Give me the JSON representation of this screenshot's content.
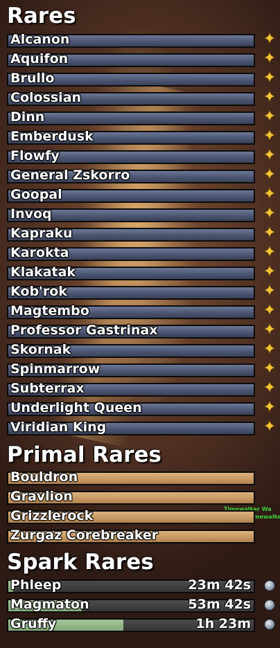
{
  "sections": {
    "rares": {
      "title": "Rares",
      "items": [
        "Alcanon",
        "Aquifon",
        "Brullo",
        "Colossian",
        "Dinn",
        "Emberdusk",
        "Flowfy",
        "General Zskorro",
        "Goopal",
        "Invoq",
        "Kapraku",
        "Karokta",
        "Klakatak",
        "Kob'rok",
        "Magtembo",
        "Professor Gastrinax",
        "Skornak",
        "Spinmarrow",
        "Subterrax",
        "Underlight Queen",
        "Viridian King"
      ]
    },
    "primal": {
      "title": "Primal Rares",
      "items": [
        "Bouldron",
        "Gravlion",
        "Grizzlerock",
        "Zurgaz Corebreaker"
      ]
    },
    "spark": {
      "title": "Spark Rares",
      "items": [
        {
          "name": "Phleep",
          "timer": "23m 42s",
          "progress": 0.02
        },
        {
          "name": "Magmaton",
          "timer": "53m 42s",
          "progress": 0.3
        },
        {
          "name": "Gruffy",
          "timer": "1h 23m",
          "progress": 0.47
        }
      ]
    }
  },
  "overlay": {
    "line1": "Timewalker Wa",
    "line2": "<The Timewalke"
  },
  "colors": {
    "rare_bar": "#4c5672",
    "primal_bar": "#c99a63",
    "spark_fill": "#84a87a",
    "star": "#f3c233"
  },
  "icons": {
    "rare_action": "star-icon",
    "spark_action": "gear-icon"
  }
}
